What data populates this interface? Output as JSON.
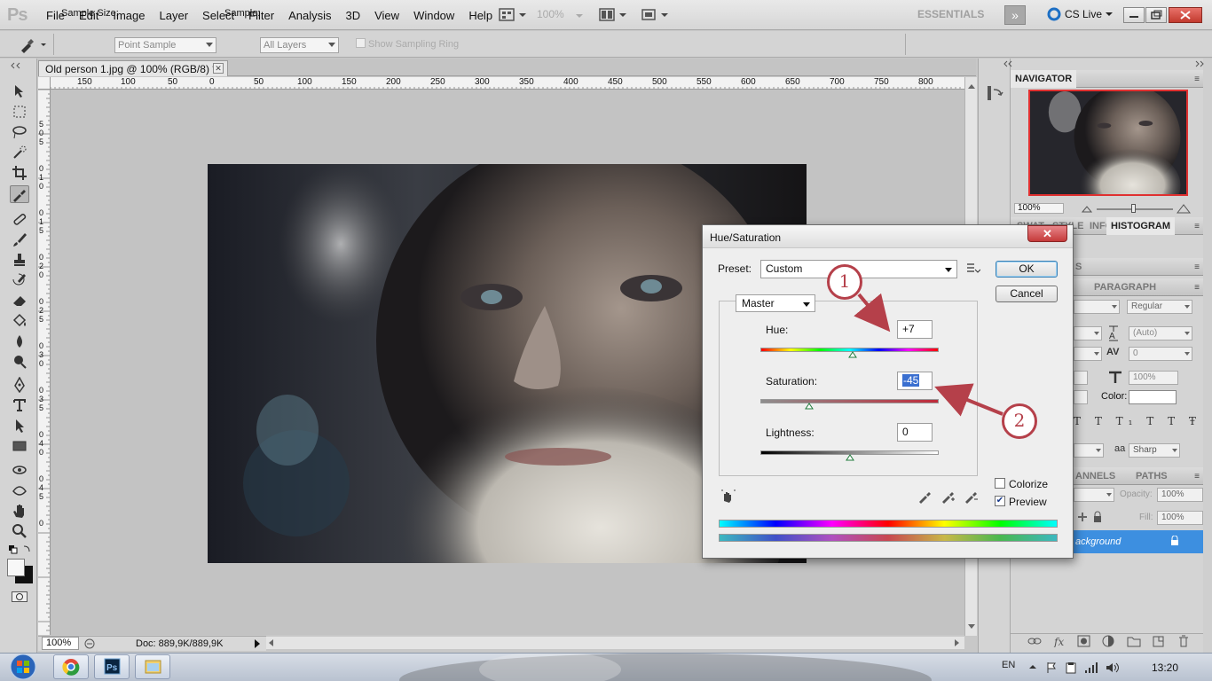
{
  "menubar": {
    "app_logo": "Ps",
    "items": [
      "File",
      "Edit",
      "Image",
      "Layer",
      "Select",
      "Filter",
      "Analysis",
      "3D",
      "View",
      "Window",
      "Help"
    ],
    "zoom_readout": "100%",
    "workspace": "ESSENTIALS",
    "cs_live": "CS Live",
    "icons": [
      "launch-bridge-icon",
      "screen-mode-icon",
      "arrange-documents-icon",
      "workspace-more-icon",
      "cs-live-icon"
    ]
  },
  "options_bar": {
    "tool_icon": "eyedropper-icon",
    "sample_size_label": "Sample Size:",
    "sample_size_value": "Point Sample",
    "sample_label": "Sample:",
    "sample_value": "All Layers",
    "show_ring_label": "Show Sampling Ring"
  },
  "document": {
    "tab_title": "Old person 1.jpg @ 100% (RGB/8) *",
    "close_glyph": "✕",
    "ruler_h_labels": [
      "150",
      "100",
      "50",
      "0",
      "50",
      "100",
      "150",
      "200",
      "250",
      "300",
      "350",
      "400",
      "450",
      "500",
      "550",
      "600",
      "650",
      "700",
      "750",
      "800"
    ],
    "ruler_v_labels": [
      "5",
      "0",
      "5",
      "0",
      "1",
      "0",
      "0",
      "1",
      "5",
      "0",
      "2",
      "0",
      "0",
      "2",
      "5",
      "0",
      "3",
      "0",
      "0",
      "3",
      "5",
      "0",
      "4",
      "0",
      "0",
      "4",
      "5",
      "0"
    ]
  },
  "status_bar": {
    "zoom": "100%",
    "doc_info": "Doc: 889,9K/889,9K"
  },
  "panels": {
    "navigator_title": "NAVIGATOR",
    "navigator_zoom": "100%",
    "histogram_tabs": [
      "SWAT",
      "STYLE",
      "INFO",
      "HISTOGRAM"
    ],
    "character_tabs": [
      "S"
    ],
    "paragraph_tab": "PARAGRAPH",
    "font_style": "Regular",
    "leading": "(Auto)",
    "tracking": "0",
    "scale": "100%",
    "color_label": "Color:",
    "antialias": "Sharp",
    "antialias_prefix": "aa",
    "channels_tab": "ANNELS",
    "paths_tab": "PATHS",
    "opacity_label": "Opacity:",
    "opacity": "100%",
    "fill_label": "Fill:",
    "fill": "100%",
    "layer_name": "ackground"
  },
  "dialog": {
    "title": "Hue/Saturation",
    "close_glyph": "✕",
    "preset_label": "Preset:",
    "preset_value": "Custom",
    "ok_label": "OK",
    "cancel_label": "Cancel",
    "channel": "Master",
    "hue_label": "Hue:",
    "hue_value": "+7",
    "hue_level": 7,
    "saturation_label": "Saturation:",
    "saturation_value": "-45",
    "saturation_level": -45,
    "lightness_label": "Lightness:",
    "lightness_value": "0",
    "lightness_level": 0,
    "colorize_label": "Colorize",
    "colorize_checked": false,
    "preview_label": "Preview",
    "preview_checked": true
  },
  "annotations": {
    "callout_1": "1",
    "callout_2": "2",
    "color": "#b5404a"
  },
  "taskbar": {
    "apps": [
      "chrome-icon",
      "photoshop-icon",
      "file-explorer-icon"
    ],
    "language": "EN",
    "clock": "13:20"
  }
}
